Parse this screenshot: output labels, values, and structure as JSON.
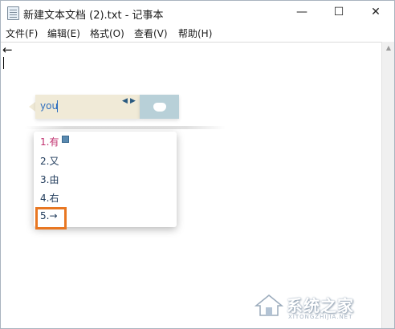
{
  "window": {
    "title": "新建文本文档 (2).txt - 记事本",
    "controls": {
      "minimize": "—",
      "maximize": "☐",
      "close": "✕"
    }
  },
  "menu": [
    {
      "label": "文件(F)"
    },
    {
      "label": "编辑(E)"
    },
    {
      "label": "格式(O)"
    },
    {
      "label": "查看(V)"
    },
    {
      "label": "帮助(H)"
    }
  ],
  "editor": {
    "content": "←"
  },
  "ime": {
    "input": "you",
    "page_prev": "◀",
    "page_next": "▶",
    "candidates": [
      {
        "label": "1.有"
      },
      {
        "label": "2.又"
      },
      {
        "label": "3.由"
      },
      {
        "label": "4.右"
      },
      {
        "label": "5.→"
      }
    ]
  },
  "watermark": {
    "title": "系统之家",
    "subtitle": "XITONGZHIJIA.NET"
  }
}
